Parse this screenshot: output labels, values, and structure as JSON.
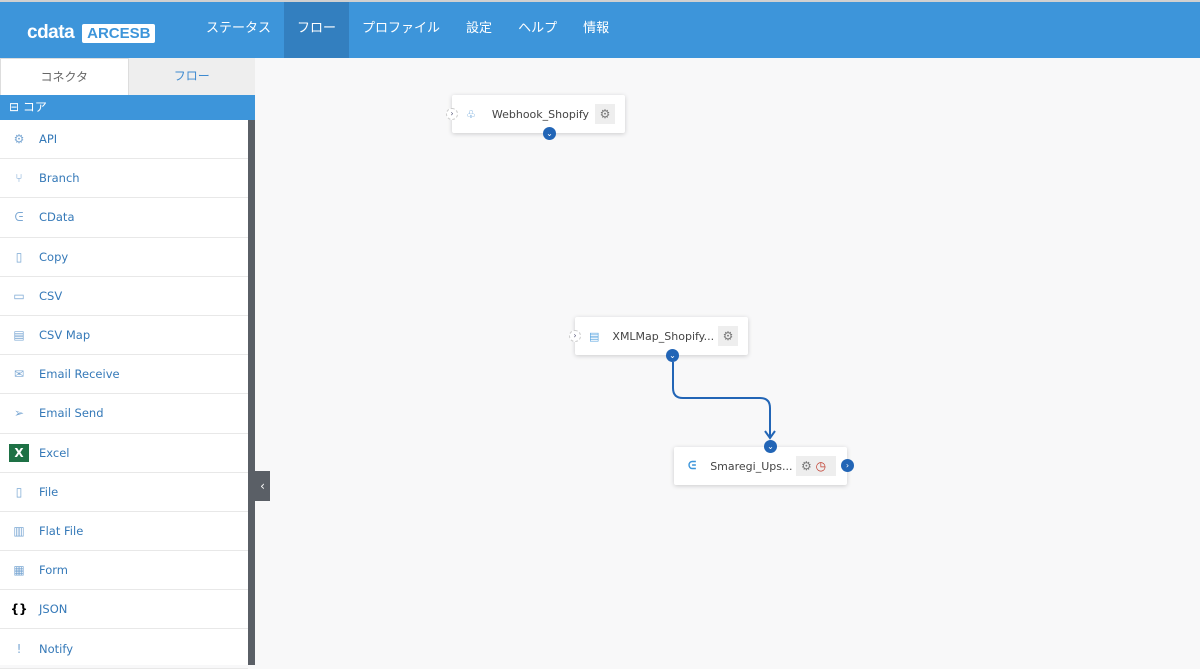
{
  "header": {
    "logo": "cdata",
    "product": "ARCESB",
    "nav": [
      "ステータス",
      "フロー",
      "プロファイル",
      "設定",
      "ヘルプ",
      "情報"
    ],
    "active": "フロー"
  },
  "sidebar": {
    "tabs": [
      "コネクタ",
      "フロー"
    ],
    "section": "⊟ コア",
    "items": [
      {
        "label": "API",
        "icon": "api-icon"
      },
      {
        "label": "Branch",
        "icon": "branch-icon"
      },
      {
        "label": "CData",
        "icon": "cdata-icon"
      },
      {
        "label": "Copy",
        "icon": "copy-icon"
      },
      {
        "label": "CSV",
        "icon": "csv-icon"
      },
      {
        "label": "CSV Map",
        "icon": "csv-map-icon"
      },
      {
        "label": "Email Receive",
        "icon": "email-receive-icon"
      },
      {
        "label": "Email Send",
        "icon": "email-send-icon"
      },
      {
        "label": "Excel",
        "icon": "excel-icon"
      },
      {
        "label": "File",
        "icon": "file-icon"
      },
      {
        "label": "Flat File",
        "icon": "flat-file-icon"
      },
      {
        "label": "Form",
        "icon": "form-icon"
      },
      {
        "label": "JSON",
        "icon": "json-icon"
      },
      {
        "label": "Notify",
        "icon": "notify-icon"
      }
    ]
  },
  "canvas": {
    "nodes": [
      {
        "name": "Webhook_Shopify"
      },
      {
        "name": "XMLMap_Shopify..."
      },
      {
        "name": "Smaregi_Ups..."
      }
    ]
  },
  "colors": {
    "accent": "#3d95da",
    "connector": "#2265b6"
  }
}
